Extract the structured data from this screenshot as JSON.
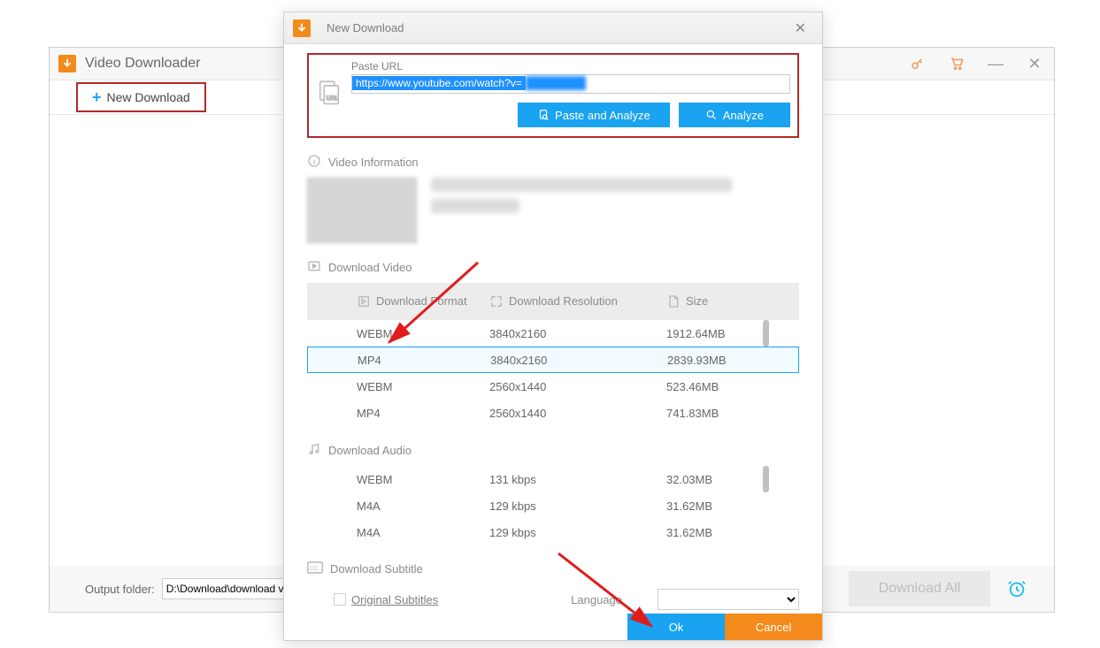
{
  "app": {
    "title": "Video Downloader",
    "new_download_btn": "New Download",
    "output_folder_label": "Output folder:",
    "output_folder_value": "D:\\Download\\download video",
    "download_all_btn": "Download All"
  },
  "modal": {
    "title": "New Download",
    "url_section_label": "Paste URL",
    "url_value_visible": "https://www.youtube.com/watch?v=",
    "btn_paste_analyze": "Paste and Analyze",
    "btn_analyze": "Analyze",
    "video_info_label": "Video Information",
    "download_video_label": "Download Video",
    "columns": {
      "format": "Download Format",
      "resolution": "Download Resolution",
      "size": "Size"
    },
    "video_rows": [
      {
        "format": "WEBM",
        "resolution": "3840x2160",
        "size": "1912.64MB",
        "selected": false
      },
      {
        "format": "MP4",
        "resolution": "3840x2160",
        "size": "2839.93MB",
        "selected": true
      },
      {
        "format": "WEBM",
        "resolution": "2560x1440",
        "size": "523.46MB",
        "selected": false
      },
      {
        "format": "MP4",
        "resolution": "2560x1440",
        "size": "741.83MB",
        "selected": false
      }
    ],
    "download_audio_label": "Download Audio",
    "audio_rows": [
      {
        "format": "WEBM",
        "bitrate": "131 kbps",
        "size": "32.03MB"
      },
      {
        "format": "M4A",
        "bitrate": "129 kbps",
        "size": "31.62MB"
      },
      {
        "format": "M4A",
        "bitrate": "129 kbps",
        "size": "31.62MB"
      }
    ],
    "download_subtitle_label": "Download Subtitle",
    "original_subtitles_label": "Original Subtitles",
    "language_label": "Language",
    "btn_ok": "Ok",
    "btn_cancel": "Cancel"
  }
}
